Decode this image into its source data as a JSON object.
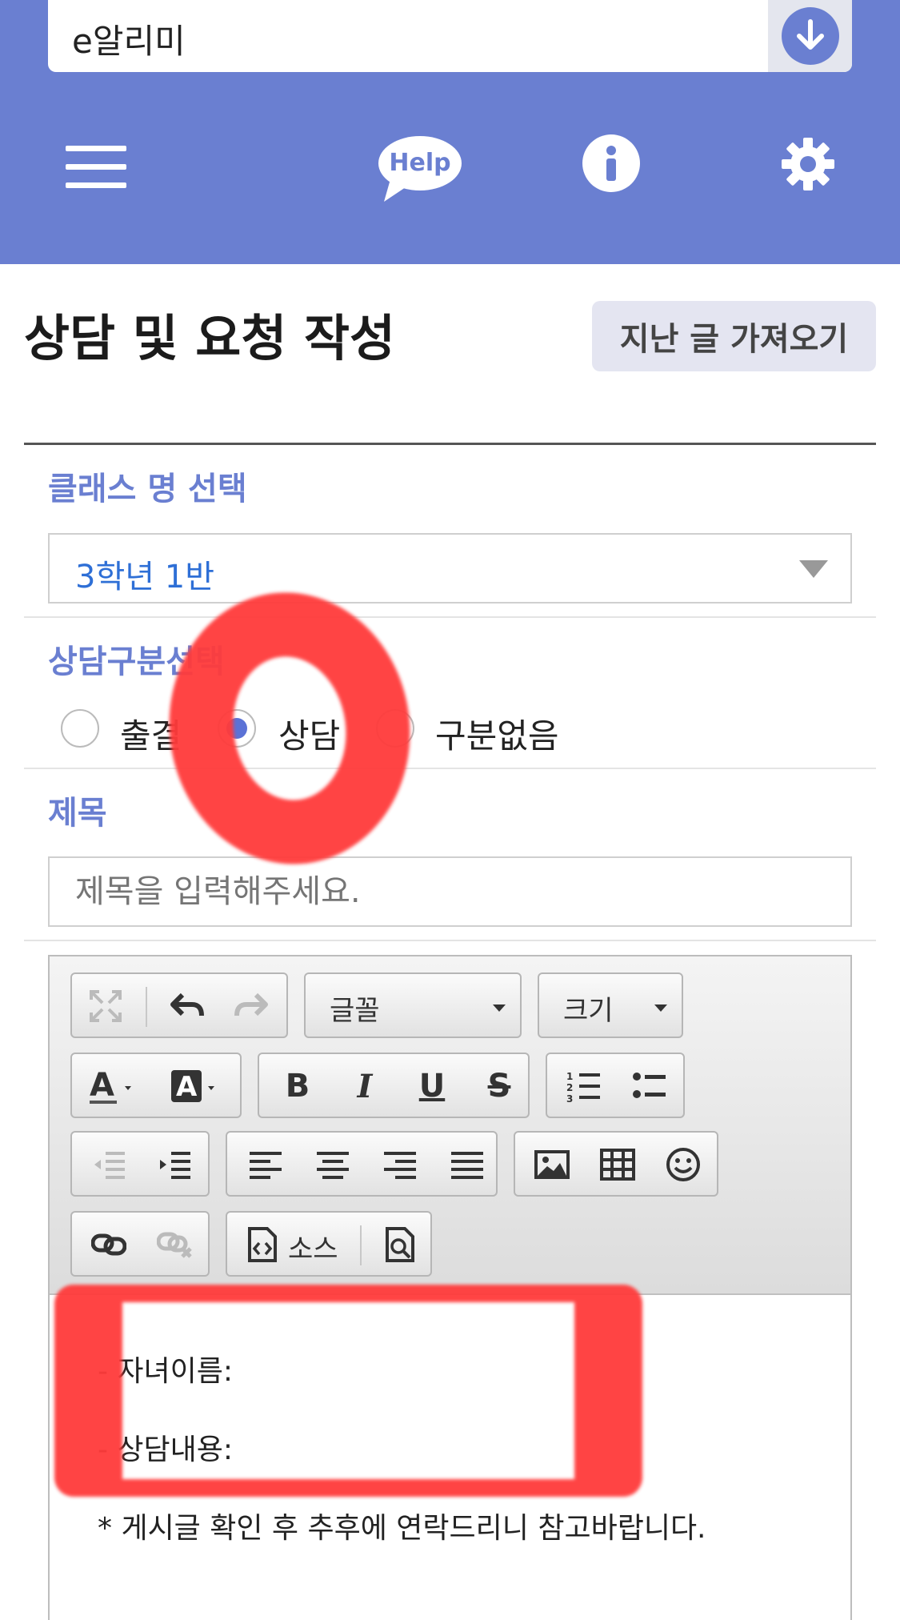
{
  "app_bar": {
    "title": "e알리미"
  },
  "header": {
    "icons": [
      "menu-icon",
      "help-icon",
      "info-icon",
      "gear-icon"
    ],
    "help_text": "Help"
  },
  "page": {
    "title": "상담 및 요청 작성",
    "load_previous_label": "지난 글 가져오기"
  },
  "class_select": {
    "label": "클래스 명 선택",
    "value": "3학년 1반"
  },
  "category": {
    "label": "상담구분선택",
    "options": [
      {
        "label": "출결",
        "checked": false
      },
      {
        "label": "상담",
        "checked": true
      },
      {
        "label": "구분없음",
        "checked": false
      }
    ]
  },
  "subject": {
    "label": "제목",
    "placeholder": "제목을 입력해주세요."
  },
  "editor": {
    "toolbar": {
      "font_label": "글꼴",
      "size_label": "크기",
      "source_label": "소스"
    },
    "content": [
      "- 자녀이름:",
      "- 상담내용:",
      "* 게시글 확인 후 추후에 연락드리니 참고바랍니다."
    ]
  },
  "colors": {
    "header_bg": "#6a7fd1",
    "accent": "#6a7fd1",
    "select_text": "#2e6fd6",
    "annotation_red": "#ff3b3b"
  }
}
